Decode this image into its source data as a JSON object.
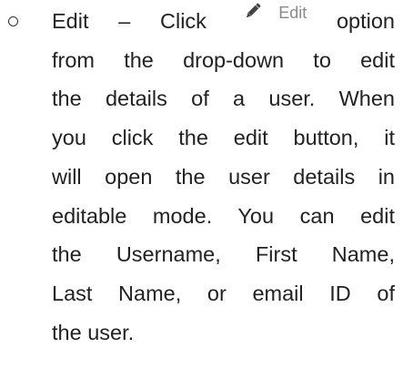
{
  "item": {
    "line1_lead": "Edit – Click",
    "chip_label": "Edit",
    "line1_tail": "option",
    "line2": "from the drop-down to edit",
    "line3": "the details of a user. When",
    "line4": "you click the edit button, it",
    "line5": "will open the user details in",
    "line6": "editable mode. You can edit",
    "line7": "the Username, First Name,",
    "line8": "Last Name, or email ID of",
    "line9": "the user."
  },
  "icons": {
    "bullet": "hollow-circle-bullet",
    "edit": "pencil-icon"
  },
  "colors": {
    "text": "#222222",
    "chip_label": "#8a8a8a",
    "pencil": "#444444"
  }
}
